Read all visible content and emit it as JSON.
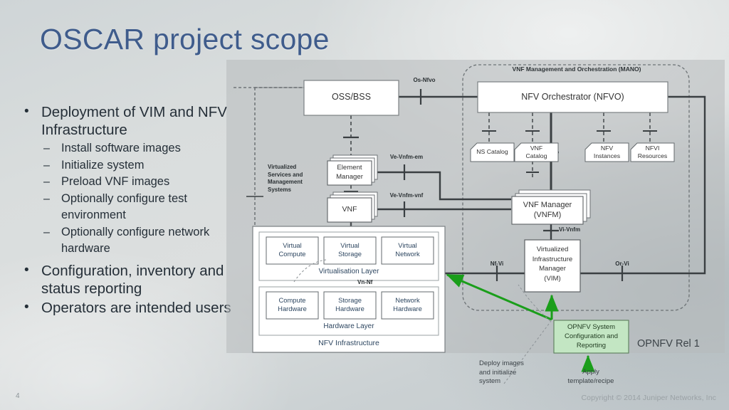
{
  "slide": {
    "title": "OSCAR project scope",
    "number": "4",
    "copyright": "Copyright © 2014 Juniper Networks, Inc",
    "title_color": "#3f5c8c"
  },
  "bullets": [
    {
      "level": 1,
      "text": "Deployment of VIM and NFV Infrastructure"
    },
    {
      "level": 2,
      "text": "Install software images"
    },
    {
      "level": 2,
      "text": "Initialize system"
    },
    {
      "level": 2,
      "text": "Preload VNF images"
    },
    {
      "level": 2,
      "text": "Optionally configure test environment"
    },
    {
      "level": 2,
      "text": "Optionally configure network hardware"
    },
    {
      "level": 1,
      "text": "Configuration, inventory and status reporting"
    },
    {
      "level": 1,
      "text": "Operators are intended users"
    }
  ],
  "diagram": {
    "mano_region_label": "VNF Management and Orchestration (MANO)",
    "vsms_label": "Virtualized\nServices and\nManagement\nSystems",
    "boxes": {
      "oss_bss": "OSS/BSS",
      "nfvo": "NFV Orchestrator (NFVO)",
      "element_manager": "Element\nManager",
      "vnf": "VNF",
      "vnfm": "VNF Manager\n(VNFM)",
      "vim": "Virtualized\nInfrastructure\nManager\n(VIM)",
      "ns_catalog": "NS Catalog",
      "vnf_catalog": "VNF\nCatalog",
      "nfv_instances": "NFV\nInstances",
      "nfvi_resources": "NFVI\nResources",
      "virtual_compute": "Virtual\nCompute",
      "virtual_storage": "Virtual\nStorage",
      "virtual_network": "Virtual\nNetwork",
      "compute_hardware": "Compute\nHardware",
      "storage_hardware": "Storage\nHardware",
      "network_hardware": "Network\nHardware",
      "virtualisation_layer": "Virtualisation Layer",
      "hardware_layer": "Hardware Layer",
      "nfv_infrastructure": "NFV Infrastructure"
    },
    "interfaces": {
      "os_nfvo": "Os-Nfvo",
      "ve_vnfm_em": "Ve-Vnfm-em",
      "ve_vnfm_vnf": "Ve-Vnfm-vnf",
      "vi_vnfm": "Vi-Vnfm",
      "nf_vi": "Nf-Vi",
      "or_vi": "Or-Vi",
      "vn_nf": "Vn-Nf"
    }
  },
  "annotations": {
    "opnfv_box": "OPNFV System\nConfiguration and\nReporting",
    "opnfv_rel": "OPNFV Rel 1",
    "deploy_note": "Deploy images\nand initialize\nsystem",
    "apply_note": "Apply\ntemplate/recipe",
    "accent_green": "#1a9e1a",
    "opnfv_box_fill": "#c3e6c3"
  }
}
